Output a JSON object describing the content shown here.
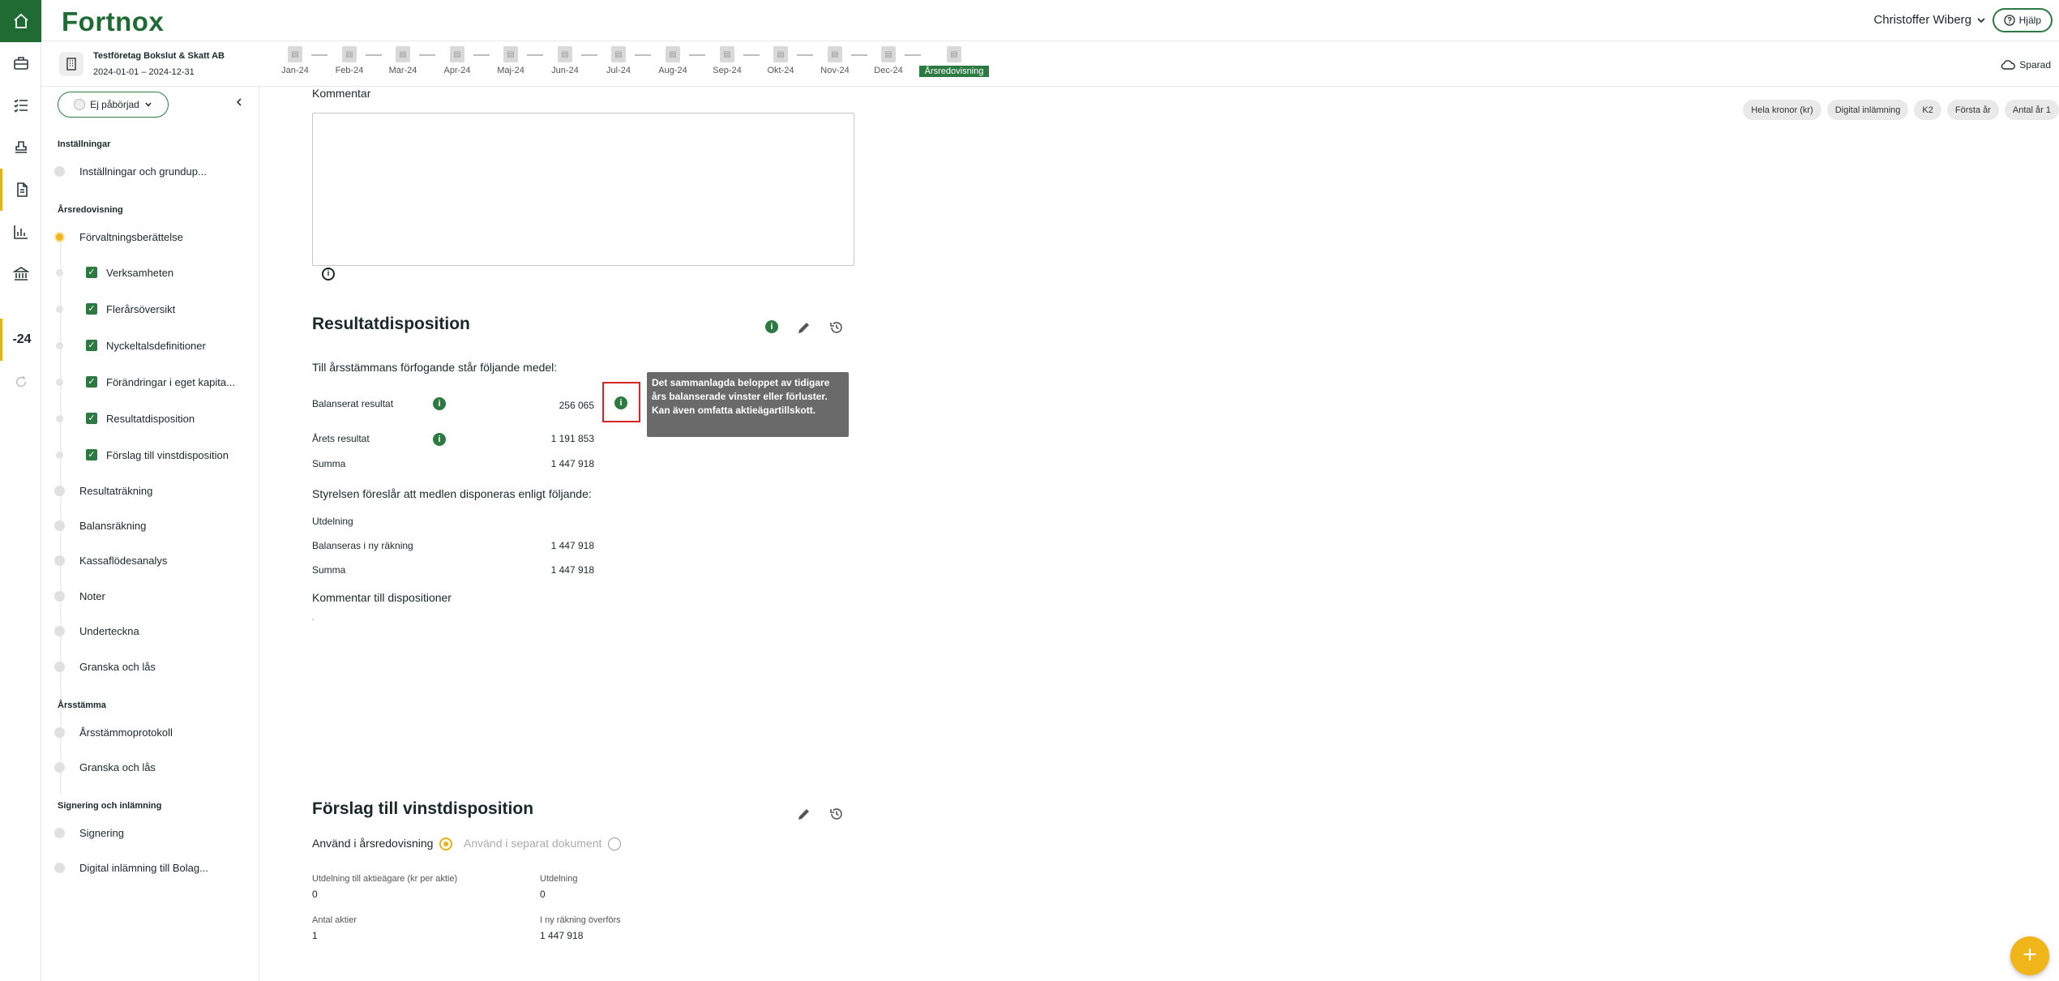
{
  "header": {
    "logo": "Fortnox",
    "user_name": "Christoffer Wiberg",
    "help_label": "Hjälp"
  },
  "company": {
    "name": "Testföretag Bokslut & Skatt AB",
    "period": "2024-01-01 – 2024-12-31"
  },
  "timeline": {
    "months": [
      "Jan-24",
      "Feb-24",
      "Mar-24",
      "Apr-24",
      "Maj-24",
      "Jun-24",
      "Jul-24",
      "Aug-24",
      "Sep-24",
      "Okt-24",
      "Nov-24",
      "Dec-24"
    ],
    "current": "Årsredovisning",
    "saved_label": "Sparad"
  },
  "rail": {
    "year_label": "-24"
  },
  "sidebar": {
    "status": "Ej påbörjad",
    "sections": {
      "installningar": "Inställningar",
      "arsredovisning": "Årsredovisning",
      "arsstamma": "Årsstämma",
      "signering": "Signering och inlämning"
    },
    "items": {
      "installningar_grund": "Inställningar och grundup...",
      "forvaltning": "Förvaltningsberättelse",
      "verksamheten": "Verksamheten",
      "flerarsoversikt": "Flerårsöversikt",
      "nyckeltal": "Nyckeltalsdefinitioner",
      "forandringar": "Förändringar i eget kapita...",
      "resultatdisposition": "Resultatdisposition",
      "forslag": "Förslag till vinstdisposition",
      "resultatrakning": "Resultaträkning",
      "balansrakning": "Balansräkning",
      "kassaflode": "Kassaflödesanalys",
      "noter": "Noter",
      "underteckna": "Underteckna",
      "granska1": "Granska och lås",
      "arsstammoprotokoll": "Årsstämmoprotokoll",
      "granska2": "Granska och lås",
      "signering": "Signering",
      "digital": "Digital inlämning till Bolag..."
    }
  },
  "chips": [
    "Hela kronor (kr)",
    "Digital inlämning",
    "K2",
    "Första år",
    "Antal år 1"
  ],
  "main": {
    "kommentar_label": "Kommentar",
    "resultatdisposition": {
      "title": "Resultatdisposition",
      "intro": "Till årsstämmans förfogande står följande medel:",
      "rows": [
        {
          "label": "Balanserat resultat",
          "value": "256 065"
        },
        {
          "label": "Årets resultat",
          "value": "1 191 853"
        },
        {
          "label": "Summa",
          "value": "1 447 918"
        }
      ],
      "proposal_intro": "Styrelsen föreslår att medlen disponeras enligt följande:",
      "prop_rows": [
        {
          "label": "Utdelning",
          "value": ""
        },
        {
          "label": "Balanseras i ny räkning",
          "value": "1 447 918"
        },
        {
          "label": "Summa",
          "value": "1 447 918"
        }
      ],
      "comment_label": "Kommentar till dispositioner"
    },
    "tooltip": "Det sammanlagda beloppet av tidigare års balanserade vinster eller förluster. Kan även omfatta aktieägartillskott.",
    "forslag": {
      "title": "Förslag till vinstdisposition",
      "use_in_report": "Använd i årsredovisning",
      "use_separate": "Använd i separat dokument",
      "fields": {
        "utdelning_per_aktie_label": "Utdelning till aktieägare (kr per aktie)",
        "utdelning_per_aktie": "0",
        "utdelning_label": "Utdelning",
        "utdelning": "0",
        "antal_aktier_label": "Antal aktier",
        "antal_aktier": "1",
        "ny_rakning_label": "I ny räkning överförs",
        "ny_rakning": "1 447 918"
      }
    }
  },
  "colors": {
    "brand_green": "#1f6b33",
    "accent_yellow": "#f0b619",
    "highlight_red": "#d62626"
  }
}
